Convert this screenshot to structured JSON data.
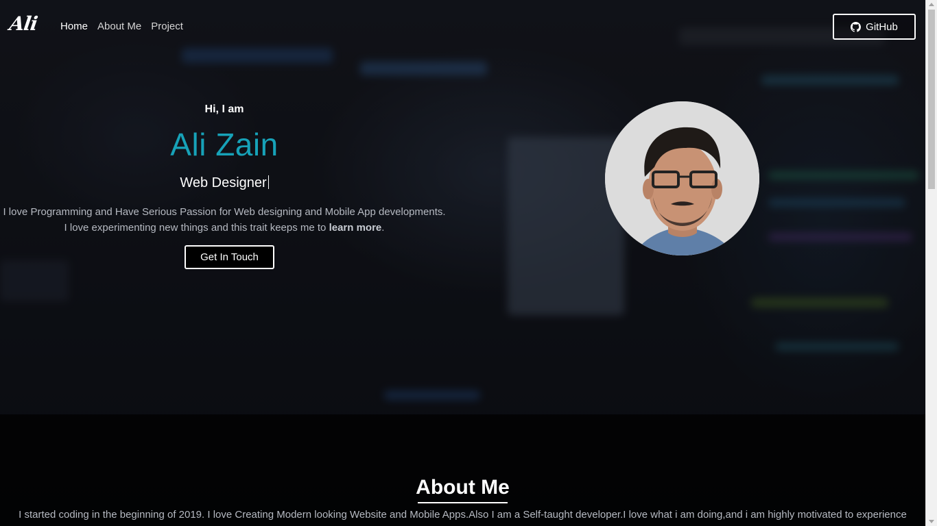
{
  "navbar": {
    "logo": "Ali",
    "links": [
      {
        "label": "Home",
        "active": true
      },
      {
        "label": "About Me",
        "active": false
      },
      {
        "label": "Project",
        "active": false
      }
    ],
    "github_label": "GitHub",
    "github_icon": "github-icon"
  },
  "hero": {
    "greeting": "Hi, I am",
    "name": "Ali Zain",
    "role": "Web Designer",
    "description_line1": "I love Programming and Have Serious Passion for Web designing and Mobile App developments.",
    "description_line2_prefix": "I love experimenting new things and this trait keeps me to",
    "description_line2_bold": "learn more",
    "description_line2_suffix": ".",
    "cta_label": "Get In Touch"
  },
  "about": {
    "title": "About Me",
    "text": "I started coding in the beginning of 2019. I love Creating Modern looking Website and Mobile Apps.Also I am a Self-taught developer.I love what i am doing,and i am highly motivated to experience"
  },
  "colors": {
    "accent": "#17a2b8",
    "background": "#0b0d12"
  }
}
